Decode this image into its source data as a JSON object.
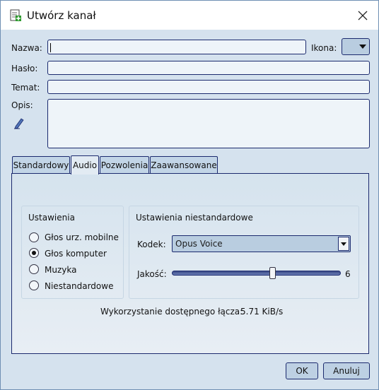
{
  "window": {
    "title": "Utwórz kanał"
  },
  "form": {
    "name_label": "Nazwa:",
    "name_value": "",
    "icon_label": "Ikona:",
    "password_label": "Hasło:",
    "password_value": "",
    "topic_label": "Temat:",
    "topic_value": "",
    "description_label": "Opis:",
    "description_value": ""
  },
  "tabs": [
    {
      "label": "Standardowy",
      "active": false
    },
    {
      "label": "Audio",
      "active": true
    },
    {
      "label": "Pozwolenia",
      "active": false
    },
    {
      "label": "Zaawansowane",
      "active": false
    }
  ],
  "audio": {
    "presets_title": "Ustawienia",
    "presets": [
      {
        "label": "Głos urz. mobilne",
        "checked": false
      },
      {
        "label": "Głos komputer",
        "checked": true
      },
      {
        "label": "Muzyka",
        "checked": false
      },
      {
        "label": "Niestandardowe",
        "checked": false
      }
    ],
    "custom_title": "Ustawienia niestandardowe",
    "codec_label": "Kodek:",
    "codec_value": "Opus Voice",
    "quality_label": "Jakość:",
    "quality_value": "6",
    "quality_max": 10,
    "bandwidth_label": "Wykorzystanie dostępnego łącza:",
    "bandwidth_value": "5.71 KiB/s"
  },
  "buttons": {
    "ok": "OK",
    "cancel": "Anuluj"
  },
  "icons": {
    "app": "channel-edit-icon",
    "close": "close-icon",
    "description_tool": "pencil-icon"
  }
}
